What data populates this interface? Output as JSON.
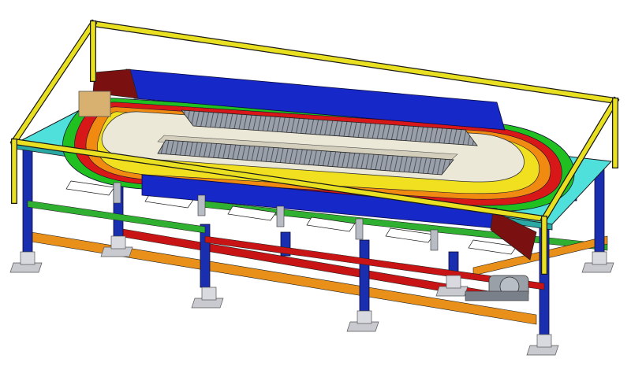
{
  "scene": {
    "subject": "oval-conveyor-assembly-render",
    "colors": {
      "background": "#ffffff",
      "frame_yellow": "#e8e020",
      "frame_outline": "#1a1a1a",
      "leg_blue": "#1a2fb0",
      "deck_cyan": "#4fe0dc",
      "belt_blue": "#1628c8",
      "belt_dark": "#7a1010",
      "track_green": "#20c020",
      "track_red": "#d81818",
      "track_orange": "#f08a10",
      "track_yellow": "#f0e020",
      "table_cream": "#ece8d8",
      "rollers_gray": "#8a8f98",
      "rail_orange": "#e8901a",
      "rail_red": "#c81414",
      "rail_green": "#30b030",
      "foot_gray": "#c8cad0",
      "motor_gray": "#9aa0a8",
      "box_tan": "#d8b070"
    }
  }
}
